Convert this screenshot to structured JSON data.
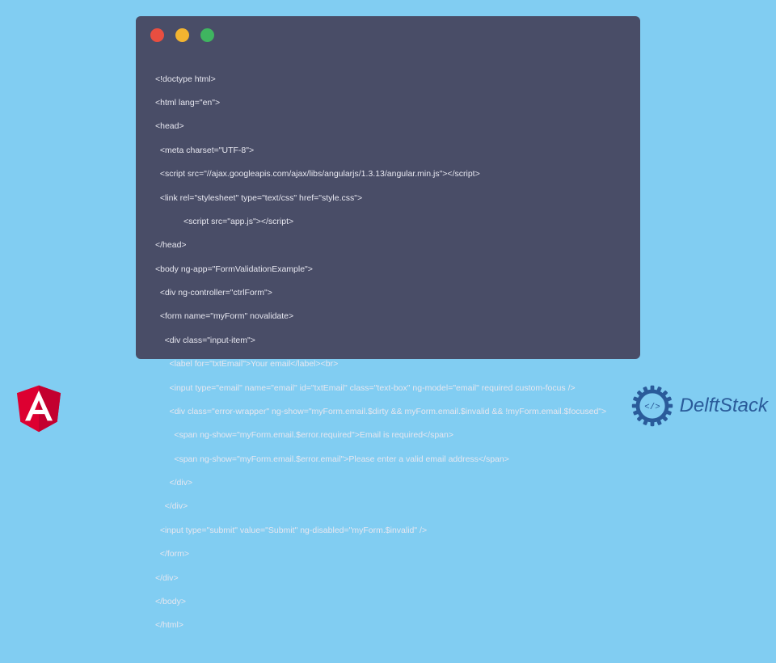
{
  "code": {
    "l0": "<!doctype html>",
    "l1": "<html lang=\"en\">",
    "l2": "<head>",
    "l3": "  <meta charset=\"UTF-8\">",
    "l4": "  <script src=\"//ajax.googleapis.com/ajax/libs/angularjs/1.3.13/angular.min.js\"></script>",
    "l5": "  <link rel=\"stylesheet\" type=\"text/css\" href=\"style.css\">",
    "l6": "            <script src=\"app.js\"></script>",
    "l7": "</head>",
    "l8": "<body ng-app=\"FormValidationExample\">",
    "l9": "  <div ng-controller=\"ctrlForm\">",
    "l10": "  <form name=\"myForm\" novalidate>",
    "l11": "    <div class=\"input-item\">",
    "l12": "      <label for=\"txtEmail\">Your email</label><br>",
    "l13": "      <input type=\"email\" name=\"email\" id=\"txtEmail\" class=\"text-box\" ng-model=\"email\" required custom-focus />",
    "l14": "      <div class=\"error-wrapper\" ng-show=\"myForm.email.$dirty && myForm.email.$invalid && !myForm.email.$focused\">",
    "l15": "        <span ng-show=\"myForm.email.$error.required\">Email is required</span>",
    "l16": "        <span ng-show=\"myForm.email.$error.email\">Please enter a valid email address</span>",
    "l17": "      </div>",
    "l18": "    </div>",
    "l19": "  <input type=\"submit\" value=\"Submit\" ng-disabled=\"myForm.$invalid\" />",
    "l20": "  </form>",
    "l21": "</div>",
    "l22": "</body>",
    "l23": "</html>"
  },
  "brand": {
    "name": "DelftStack"
  }
}
